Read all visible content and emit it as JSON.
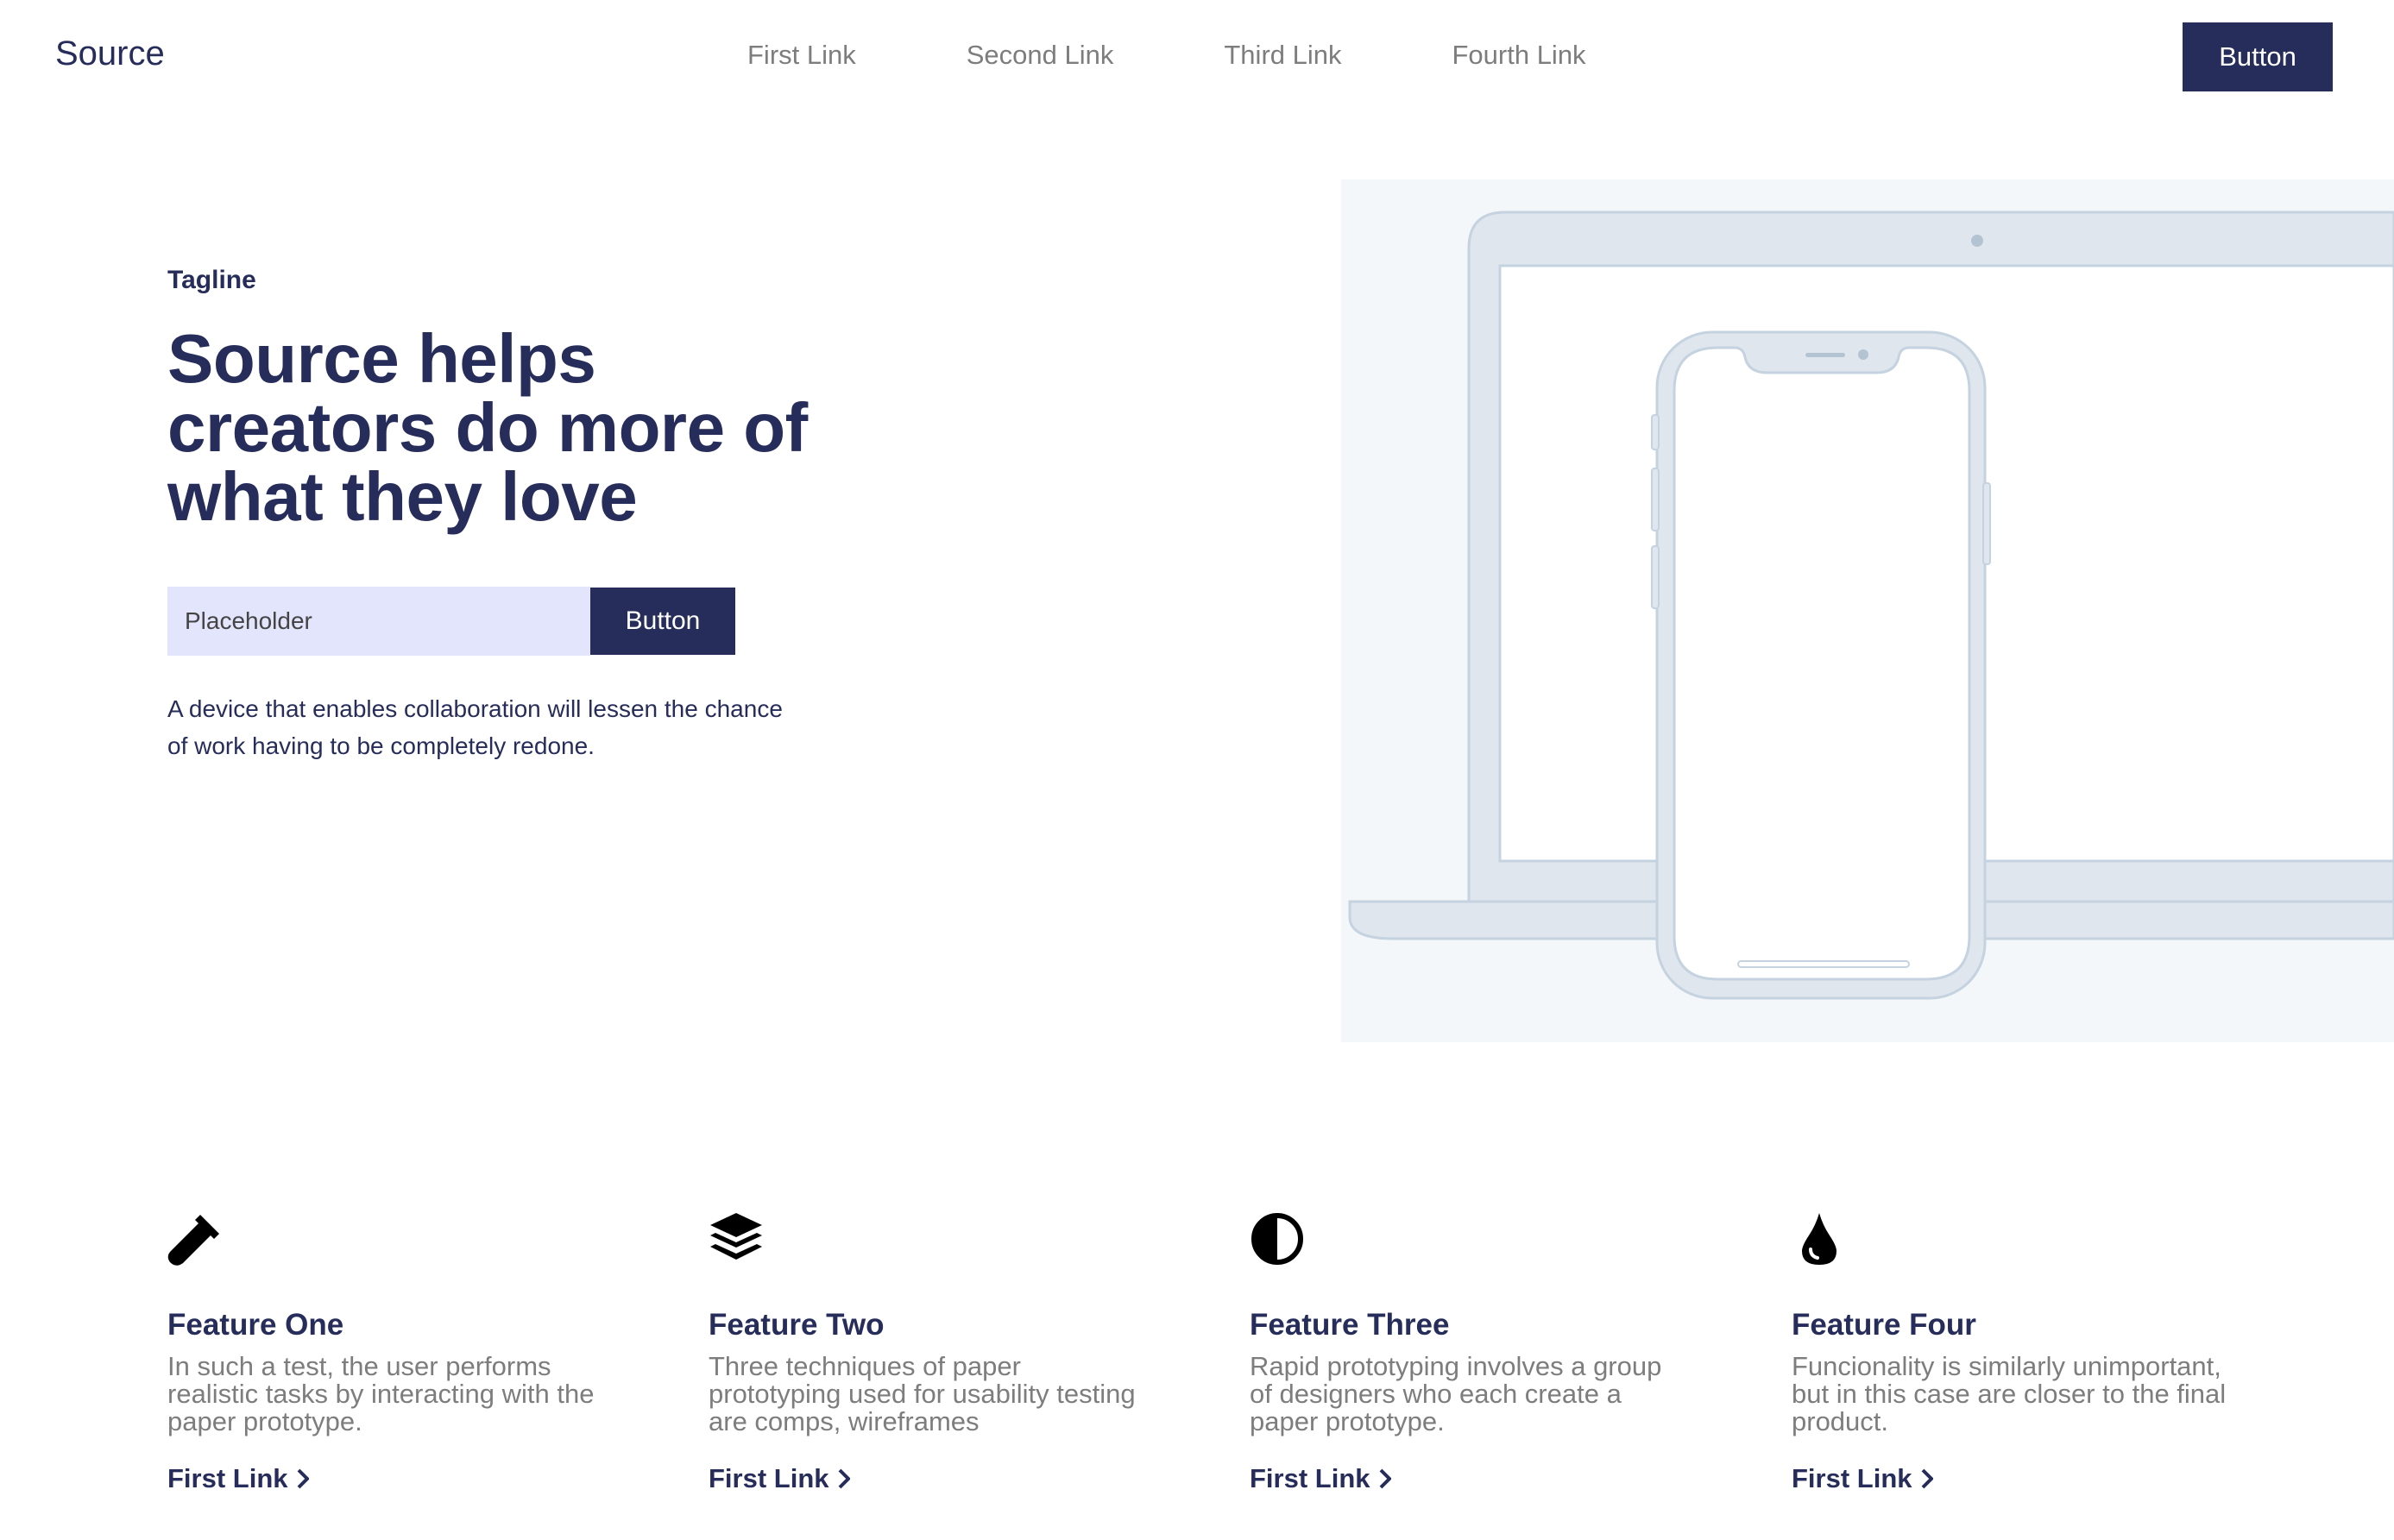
{
  "header": {
    "logo": "Source",
    "nav": [
      "First Link",
      "Second Link",
      "Third Link",
      "Fourth Link"
    ],
    "button_label": "Button"
  },
  "hero": {
    "tagline": "Tagline",
    "title": "Source helps creators do more of what they love",
    "input_placeholder": "Placeholder",
    "button_label": "Button",
    "text": "A device that enables collaboration will lessen the chance of work having to be completely redone."
  },
  "features": [
    {
      "icon": "test-tube-icon",
      "title": "Feature One",
      "text": "In such a test, the user performs realistic tasks by interacting with the paper prototype.",
      "link": "First Link"
    },
    {
      "icon": "layers-icon",
      "title": "Feature Two",
      "text": "Three techniques of paper prototyping used for usability testing are comps, wireframes",
      "link": "First Link"
    },
    {
      "icon": "half-circle-contrast-icon",
      "title": "Feature Three",
      "text": "Rapid prototyping involves a group of designers who each create a paper prototype.",
      "link": "First Link"
    },
    {
      "icon": "droplet-icon",
      "title": "Feature Four",
      "text": "Funcionality is similarly unimportant, but in this case are closer to the final product.",
      "link": "First Link"
    }
  ],
  "colors": {
    "primary": "#272d5a",
    "muted_text": "#7d7d7d",
    "input_bg": "#e3e5fc",
    "illustration_bg": "#f4f7fa",
    "device_fill": "#dfe6ee",
    "device_stroke": "#c5d2df"
  }
}
